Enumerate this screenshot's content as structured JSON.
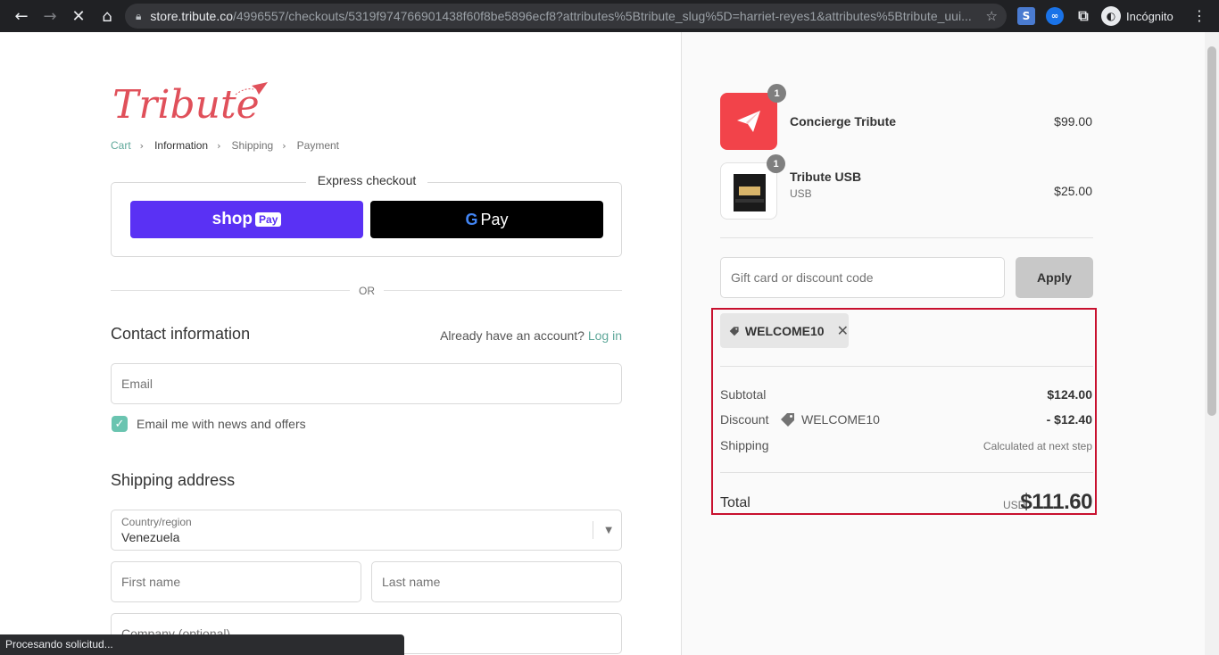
{
  "browser": {
    "url_host": "store.tribute.co",
    "url_path": "/4996557/checkouts/5319f974766901438f60f8be5896ecf8?attributes%5Btribute_slug%5D=harriet-reyes1&attributes%5Btribute_uui...",
    "profile_label": "Incógnito",
    "status_text": "Procesando solicitud..."
  },
  "brand": {
    "logo_text": "Tribute",
    "accent_color": "#e0505a"
  },
  "breadcrumb": {
    "cart": "Cart",
    "information": "Information",
    "shipping": "Shipping",
    "payment": "Payment"
  },
  "express": {
    "title": "Express checkout",
    "shop_label": "shop",
    "shop_pay_label": "Pay",
    "gpay_g": "G",
    "gpay_label": "Pay"
  },
  "divider_or": "OR",
  "contact": {
    "title": "Contact information",
    "account_prompt": "Already have an account?",
    "login_link": "Log in",
    "email_placeholder": "Email",
    "newsletter_label": "Email me with news and offers"
  },
  "shipping": {
    "title": "Shipping address",
    "country_caption": "Country/region",
    "country_value": "Venezuela",
    "first_name_placeholder": "First name",
    "last_name_placeholder": "Last name",
    "company_placeholder": "Company (optional)"
  },
  "summary": {
    "items": [
      {
        "name": "Concierge Tribute",
        "variant": "",
        "price": "$99.00",
        "qty": "1"
      },
      {
        "name": "Tribute USB",
        "variant": "USB",
        "price": "$25.00",
        "qty": "1"
      }
    ],
    "discount_placeholder": "Gift card or discount code",
    "apply_label": "Apply",
    "applied_code": "WELCOME10",
    "subtotal_label": "Subtotal",
    "subtotal_value": "$124.00",
    "discount_label": "Discount",
    "discount_code": "WELCOME10",
    "discount_value": "- $12.40",
    "shipping_label": "Shipping",
    "shipping_value": "Calculated at next step",
    "total_label": "Total",
    "currency": "USD",
    "total_value": "$111.60"
  }
}
